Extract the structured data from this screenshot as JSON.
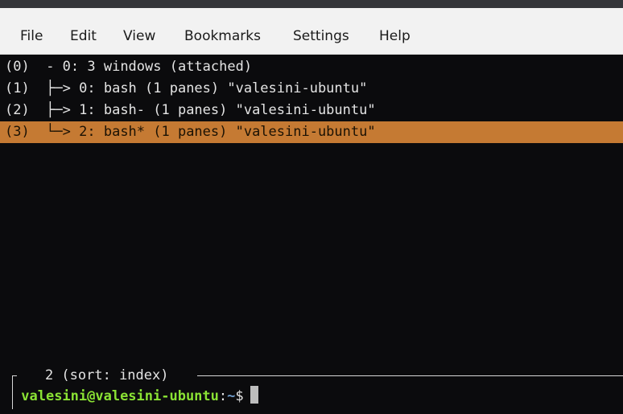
{
  "menu": {
    "file": "File",
    "edit": "Edit",
    "view": "View",
    "bookmarks": "Bookmarks",
    "settings": "Settings",
    "help": "Help"
  },
  "tree": {
    "rows": [
      {
        "index": "(0)",
        "connector": "  - ",
        "text": "0: 3 windows (attached)"
      },
      {
        "index": "(1)",
        "connector": "  ├─> ",
        "text": "0: bash (1 panes) \"valesini-ubuntu\""
      },
      {
        "index": "(2)",
        "connector": "  ├─> ",
        "text": "1: bash- (1 panes) \"valesini-ubuntu\""
      },
      {
        "index": "(3)",
        "connector": "  └─> ",
        "text": "2: bash* (1 panes) \"valesini-ubuntu\""
      }
    ],
    "selected_row": 3
  },
  "status": {
    "text": "2 (sort: index)"
  },
  "prompt": {
    "user_host": "valesini@valesini-ubuntu",
    "separator": ":",
    "path": "~",
    "symbol": "$"
  },
  "colors": {
    "highlight": "#c57a33",
    "prompt_user": "#8ae234",
    "prompt_path": "#729fcf"
  }
}
